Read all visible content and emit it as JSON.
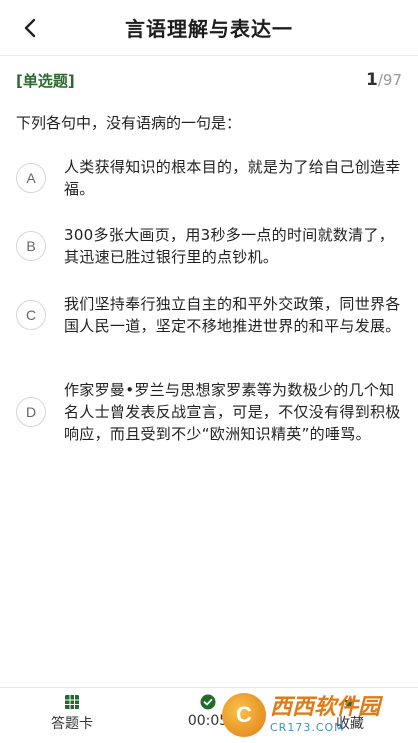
{
  "header": {
    "title": "言语理解与表达一"
  },
  "question": {
    "type": "[单选题]",
    "current": "1",
    "total": "/97",
    "stem": "下列各句中，没有语病的一句是：",
    "options": [
      {
        "letter": "A",
        "text": "人类获得知识的根本目的，就是为了给自己创造幸福。"
      },
      {
        "letter": "B",
        "text": "300多张大画页，用3秒多一点的时间就数清了，其迅速已胜过银行里的点钞机。"
      },
      {
        "letter": "C",
        "text": "我们坚持奉行独立自主的和平外交政策，同世界各国人民一道，坚定不移地推进世界的和平与发展。"
      },
      {
        "letter": "D",
        "text": "作家罗曼•罗兰与思想家罗素等为数极少的几个知名人士曾发表反战宣言，可是，不仅没有得到积极响应，而且受到不少“欧洲知识精英”的唾骂。"
      }
    ]
  },
  "bottom": {
    "card_label": "答题卡",
    "timer": "00:05",
    "fav_label": "收藏",
    "accent": "#1f6b2a"
  },
  "watermark": {
    "main": "西西软件园",
    "sub": "CR173.COM"
  }
}
